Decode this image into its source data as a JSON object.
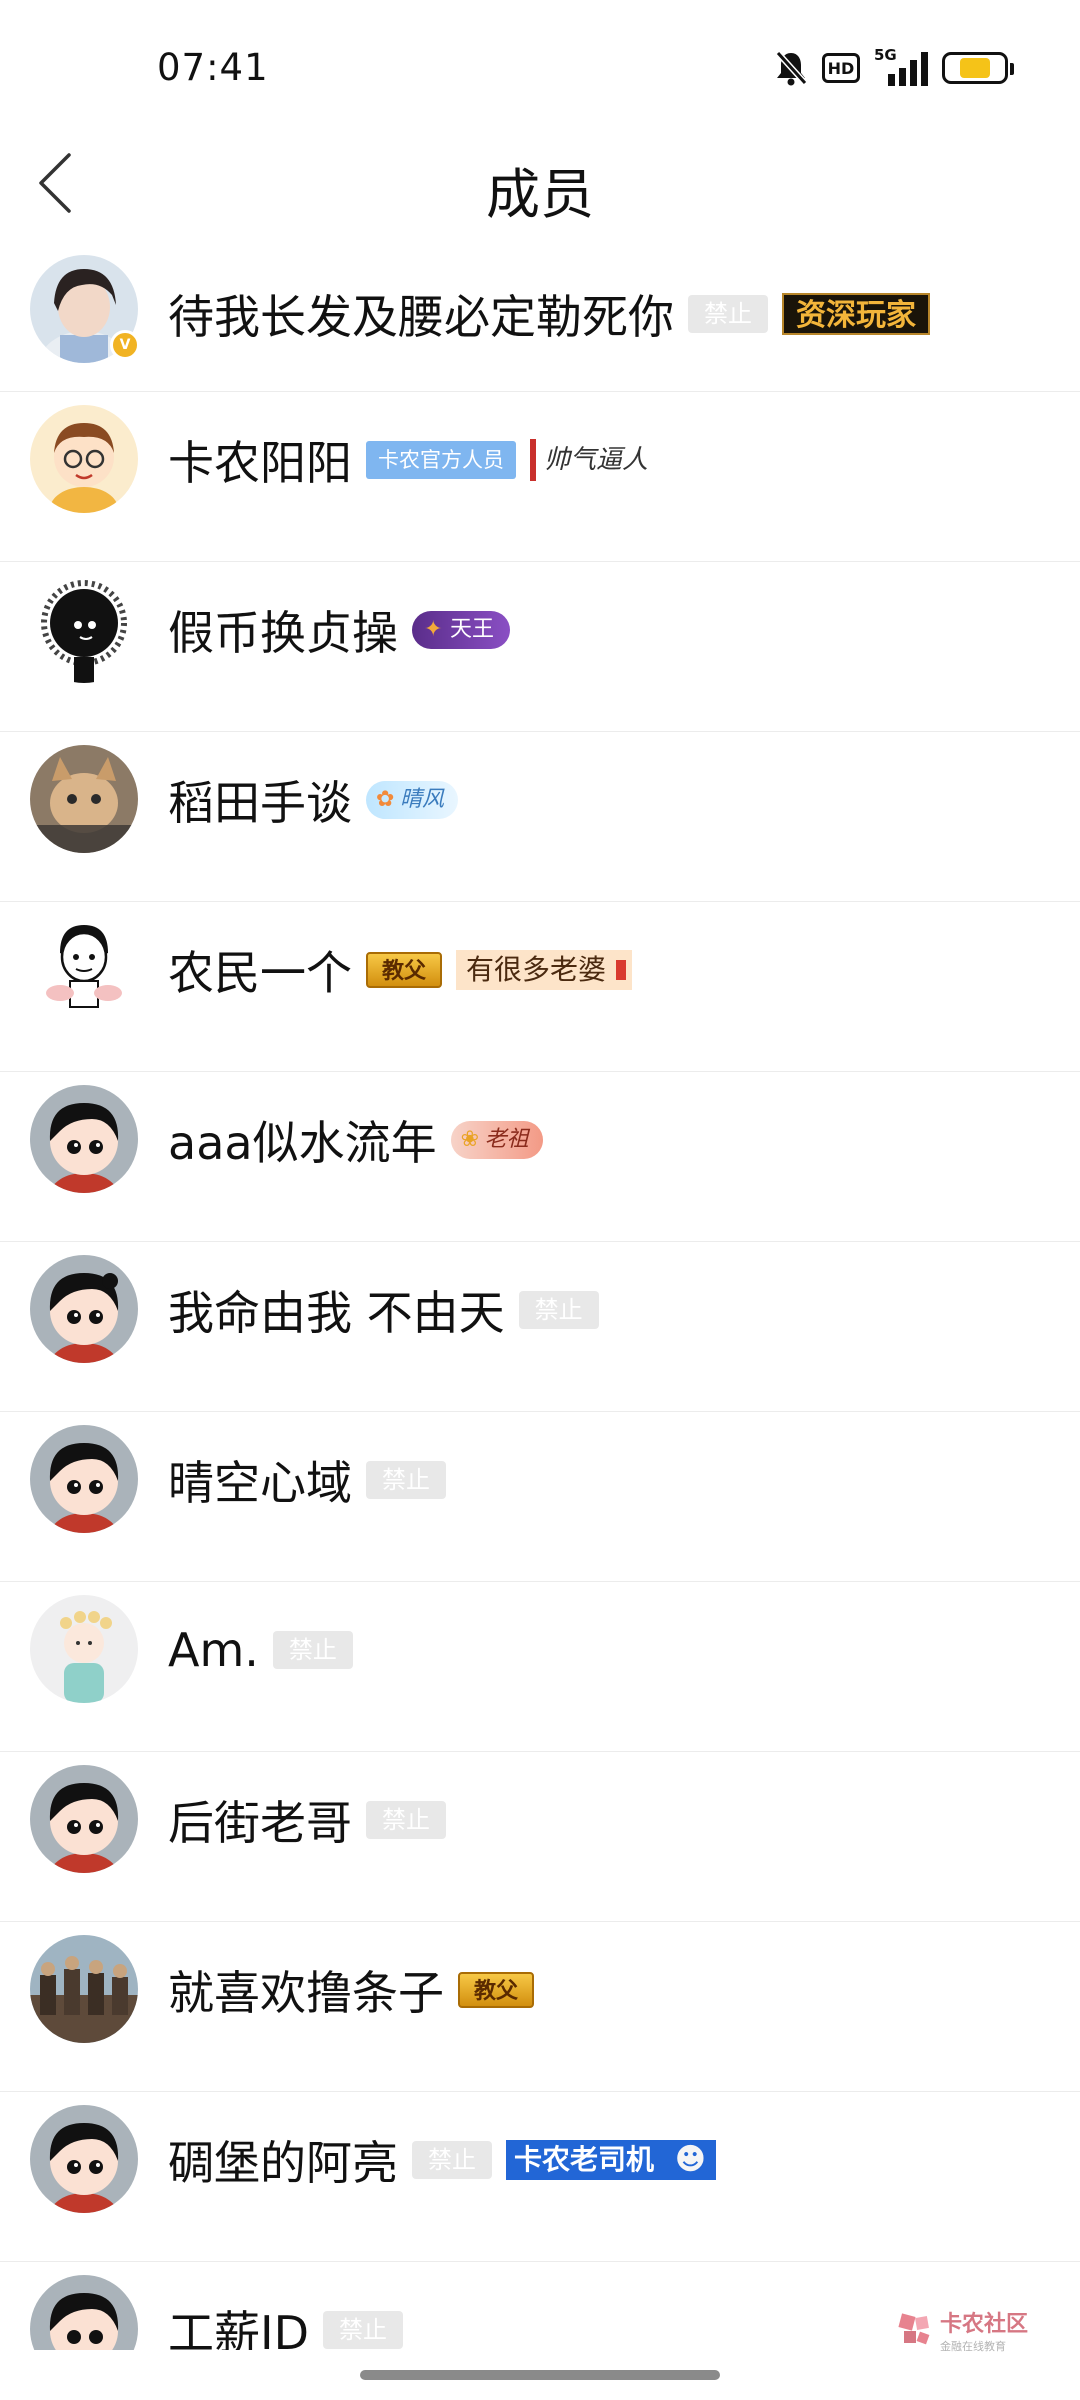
{
  "status_bar": {
    "time": "07:41",
    "hd_label": "HD",
    "network_label": "5G",
    "battery_level": 0.55
  },
  "header": {
    "title": "成员"
  },
  "members": [
    {
      "name": "待我长发及腰必定勒死你",
      "badges": {
        "ban": "禁止",
        "senior": "资深玩家"
      }
    },
    {
      "name": "卡农阳阳",
      "badges": {
        "official": "卡农官方人员",
        "handsome": "帅气逼人"
      }
    },
    {
      "name": "假币换贞操",
      "badges": {
        "king": "天王"
      }
    },
    {
      "name": "稻田手谈",
      "badges": {
        "sky": "晴风"
      }
    },
    {
      "name": "农民一个",
      "badges": {
        "godfather": "教父",
        "wives": "有很多老婆"
      }
    },
    {
      "name": "aaa似水流年",
      "badges": {
        "granny": "老祖"
      }
    },
    {
      "name": "我命由我 不由天",
      "badges": {
        "ban": "禁止"
      }
    },
    {
      "name": "晴空心域",
      "badges": {
        "ban": "禁止"
      }
    },
    {
      "name": "Am.",
      "badges": {
        "ban": "禁止"
      }
    },
    {
      "name": "后街老哥",
      "badges": {
        "ban": "禁止"
      }
    },
    {
      "name": "就喜欢撸条子",
      "badges": {
        "godfather": "教父"
      }
    },
    {
      "name": "碉堡的阿亮",
      "badges": {
        "ban": "禁止",
        "driver": "卡农老司机"
      }
    },
    {
      "name": "工薪ID",
      "badges": {
        "ban": "禁止"
      }
    }
  ],
  "watermark": {
    "title": "卡农社区",
    "subtitle": "金融在线教育"
  },
  "colors": {
    "ban_tag_bg": "#e8e8e8",
    "official_tag_bg": "#7fb6f0",
    "senior_tag_bg": "#1a1409",
    "battery_fill": "#f5c318",
    "verify_badge": "#f1b323"
  }
}
